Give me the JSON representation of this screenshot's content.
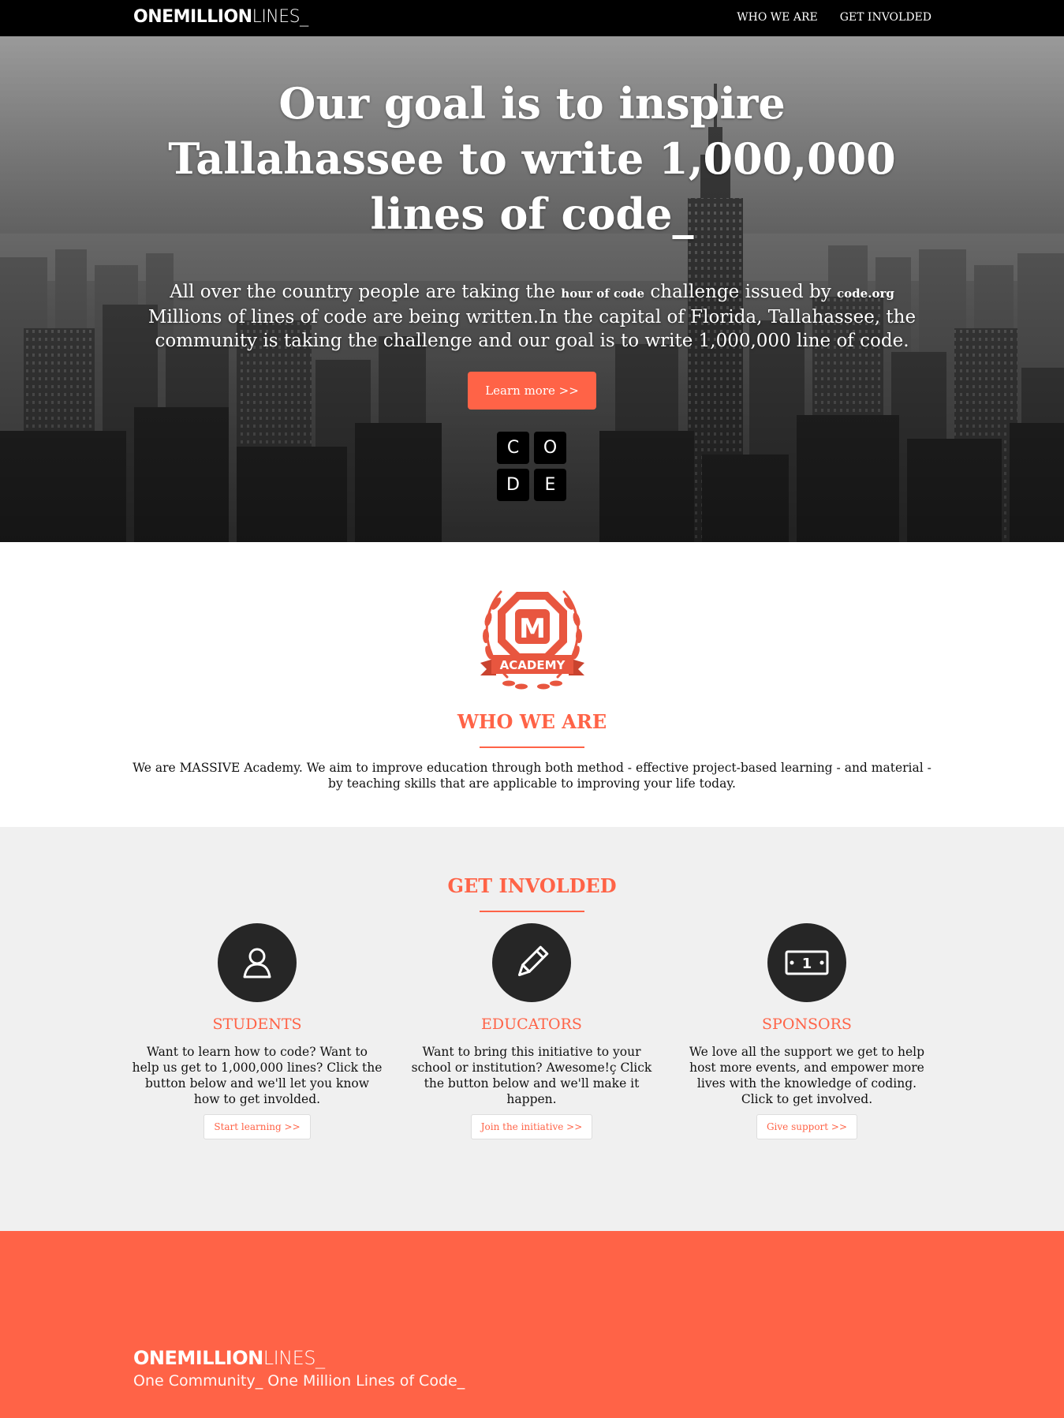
{
  "brand": {
    "bold": "ONEMILLION",
    "light": "LINES_"
  },
  "nav": {
    "items": [
      {
        "label": "WHO WE ARE"
      },
      {
        "label": "GET INVOLDED"
      }
    ]
  },
  "hero": {
    "title": "Our goal is to inspire Tallahassee to write 1,000,000 lines of code_",
    "text_part1": "All over the country people are taking the ",
    "tag1": "hour of code",
    "text_part2": " challenge issued by ",
    "tag2": "code.org",
    "text_part3": " Millions of lines of code are being written.In the capital of Florida, Tallahassee, the community is taking the challenge and our goal is to write 1,000,000 line of code.",
    "button_label": "Learn more >>",
    "code_letters": [
      "C",
      "O",
      "D",
      "E"
    ]
  },
  "who": {
    "logo_letter": "M",
    "logo_banner": "ACADEMY",
    "title": "WHO WE ARE",
    "text": "We are MASSIVE Academy. We aim to improve education through both method - effective project-based learning - and material - by teaching skills that are applicable to improving your life today."
  },
  "involved": {
    "title": "GET INVOLDED",
    "columns": [
      {
        "icon": "user-icon",
        "title": "STUDENTS",
        "text": "Want to learn how to code? Want to help us get to 1,000,000 lines? Click the button below and we'll let you know how to get involded.",
        "button": "Start learning >>"
      },
      {
        "icon": "pencil-icon",
        "title": "EDUCATORS",
        "text": "Want to bring this initiative to your school or institution? Awesome!ç Click the button below and we'll make it happen.",
        "button": "Join the initiative >>"
      },
      {
        "icon": "money-icon",
        "title": "SPONSORS",
        "text": "We love all the support we get to help host more events, and empower more lives with the knowledge of coding. Click to get involved.",
        "button": "Give support >>"
      }
    ],
    "money_glyph": "1"
  },
  "footer": {
    "brand_bold": "ONEMILLION",
    "brand_light": "LINES_",
    "tagline": "One Community_ One Million Lines of Code_"
  },
  "colors": {
    "accent": "#ff6347",
    "nav_bg": "#000000",
    "icon_bg": "#262626",
    "section_bg": "#f0f0f0"
  }
}
